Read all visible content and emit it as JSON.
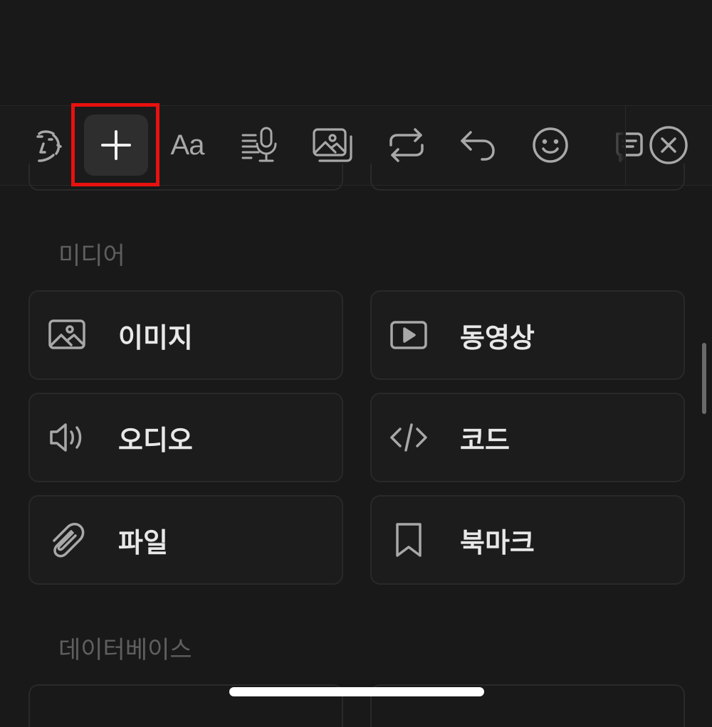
{
  "toolbar": {
    "buttons": [
      {
        "name": "ai-assist",
        "icon": "ai-face-icon",
        "label": ""
      },
      {
        "name": "add-block",
        "icon": "plus-icon",
        "label": "",
        "active": true
      },
      {
        "name": "text-style",
        "icon": "text-style-icon",
        "label": "Aa"
      },
      {
        "name": "voice-transcribe",
        "icon": "microphone-lines-icon",
        "label": ""
      },
      {
        "name": "media",
        "icon": "images-icon",
        "label": ""
      },
      {
        "name": "turn-into",
        "icon": "repeat-arrows-icon",
        "label": ""
      },
      {
        "name": "undo",
        "icon": "undo-arrow-icon",
        "label": ""
      },
      {
        "name": "emoji",
        "icon": "smiley-icon",
        "label": ""
      },
      {
        "name": "comment",
        "icon": "comment-icon",
        "label": ""
      }
    ],
    "close_icon": "close-circle-icon",
    "highlight_color": "#e8110f"
  },
  "sections": [
    {
      "title": "미디어",
      "items": [
        {
          "label": "이미지",
          "icon": "image-icon"
        },
        {
          "label": "동영상",
          "icon": "video-play-icon"
        },
        {
          "label": "오디오",
          "icon": "speaker-icon"
        },
        {
          "label": "코드",
          "icon": "code-icon"
        },
        {
          "label": "파일",
          "icon": "paperclip-icon"
        },
        {
          "label": "북마크",
          "icon": "bookmark-icon"
        }
      ]
    },
    {
      "title": "데이터베이스",
      "items": []
    }
  ]
}
